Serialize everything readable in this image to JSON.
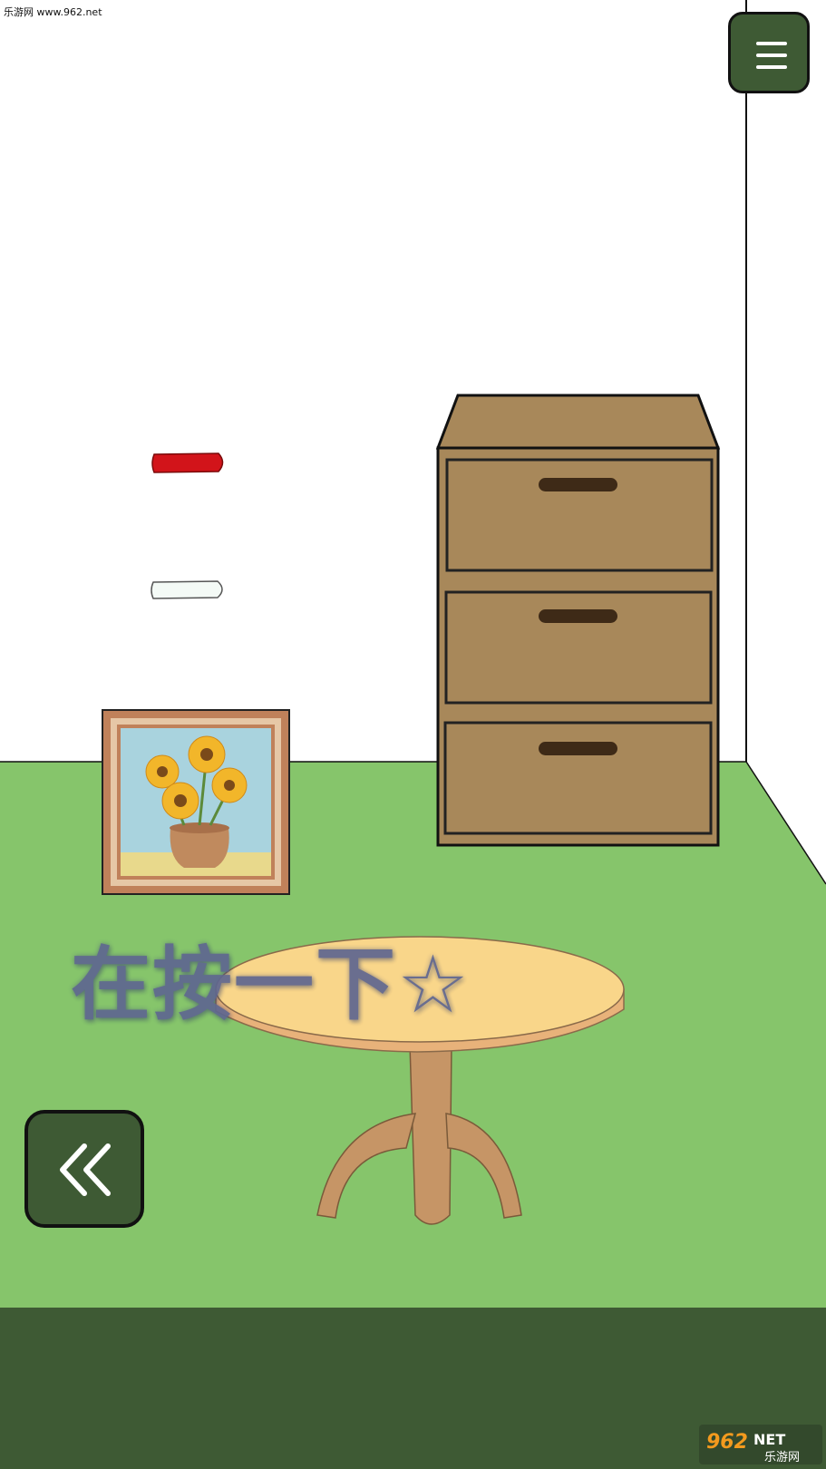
{
  "watermark": {
    "top_left": "乐游网 www.962.net",
    "brand_number": "962",
    "brand_suffix": "NET",
    "brand_chinese": "乐游网"
  },
  "menu_button": {
    "icon": "hamburger-menu-icon"
  },
  "back_button": {
    "icon": "double-chevron-left-icon"
  },
  "hint": {
    "text": "在按一下☆"
  },
  "scene_items": {
    "wall_marks": [
      "red-stick",
      "white-stick"
    ],
    "furniture": [
      "drawer-cabinet",
      "round-table",
      "sunflower-painting"
    ],
    "drawers": [
      "drawer-top",
      "drawer-middle",
      "drawer-bottom"
    ]
  },
  "colors": {
    "button": "#3e5a34",
    "floor": "#86c56b",
    "bottom_bar": "#3e5a34",
    "cabinet": "#a8885a",
    "table_top": "#f9d68a"
  }
}
